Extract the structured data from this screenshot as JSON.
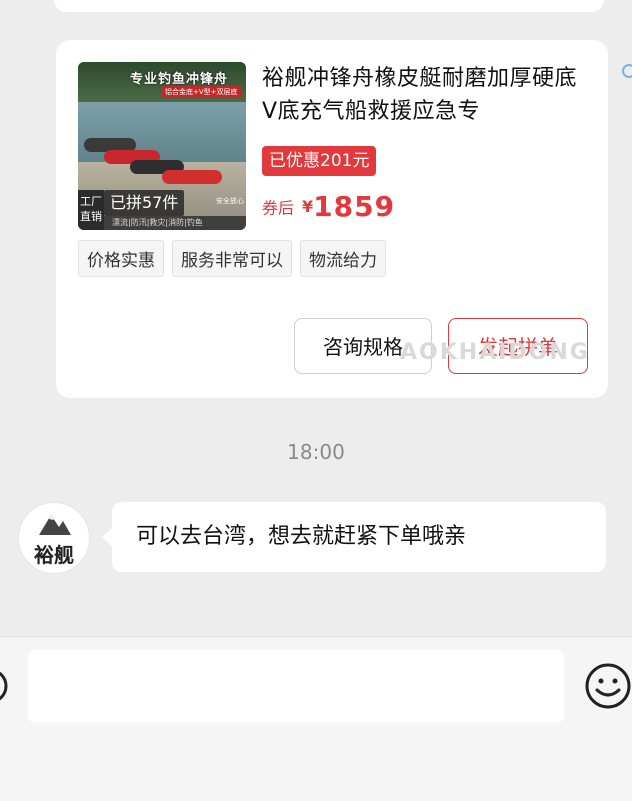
{
  "product": {
    "image": {
      "title": "专业钓鱼冲锋舟",
      "subtitle": "铝合金底+V型+双层底",
      "factory_badge": "工厂直销",
      "sold_count": "已拼57件",
      "uses": "漂流|防汛|救灾|消防|钓鱼",
      "assurance": "安全放心"
    },
    "title": "裕舰冲锋舟橡皮艇耐磨加厚硬底V底充气船救援应急专",
    "discount": "已优惠201元",
    "price_prefix": "券后",
    "currency": "¥",
    "price": "1859",
    "tags": [
      "价格实惠",
      "服务非常可以",
      "物流给力"
    ],
    "consult_label": "咨询规格",
    "group_label": "发起拼单"
  },
  "watermark": "AOKHAIDONG",
  "timestamp": "18:00",
  "message": {
    "avatar_text": "裕舰",
    "text": "可以去台湾，想去就赶紧下单哦亲"
  },
  "icons": {
    "voice": "voice-icon",
    "emoji": "emoji-icon",
    "avatar_logo": "mountain-icon"
  },
  "colors": {
    "accent": "#e4393c",
    "background": "#ededed"
  }
}
